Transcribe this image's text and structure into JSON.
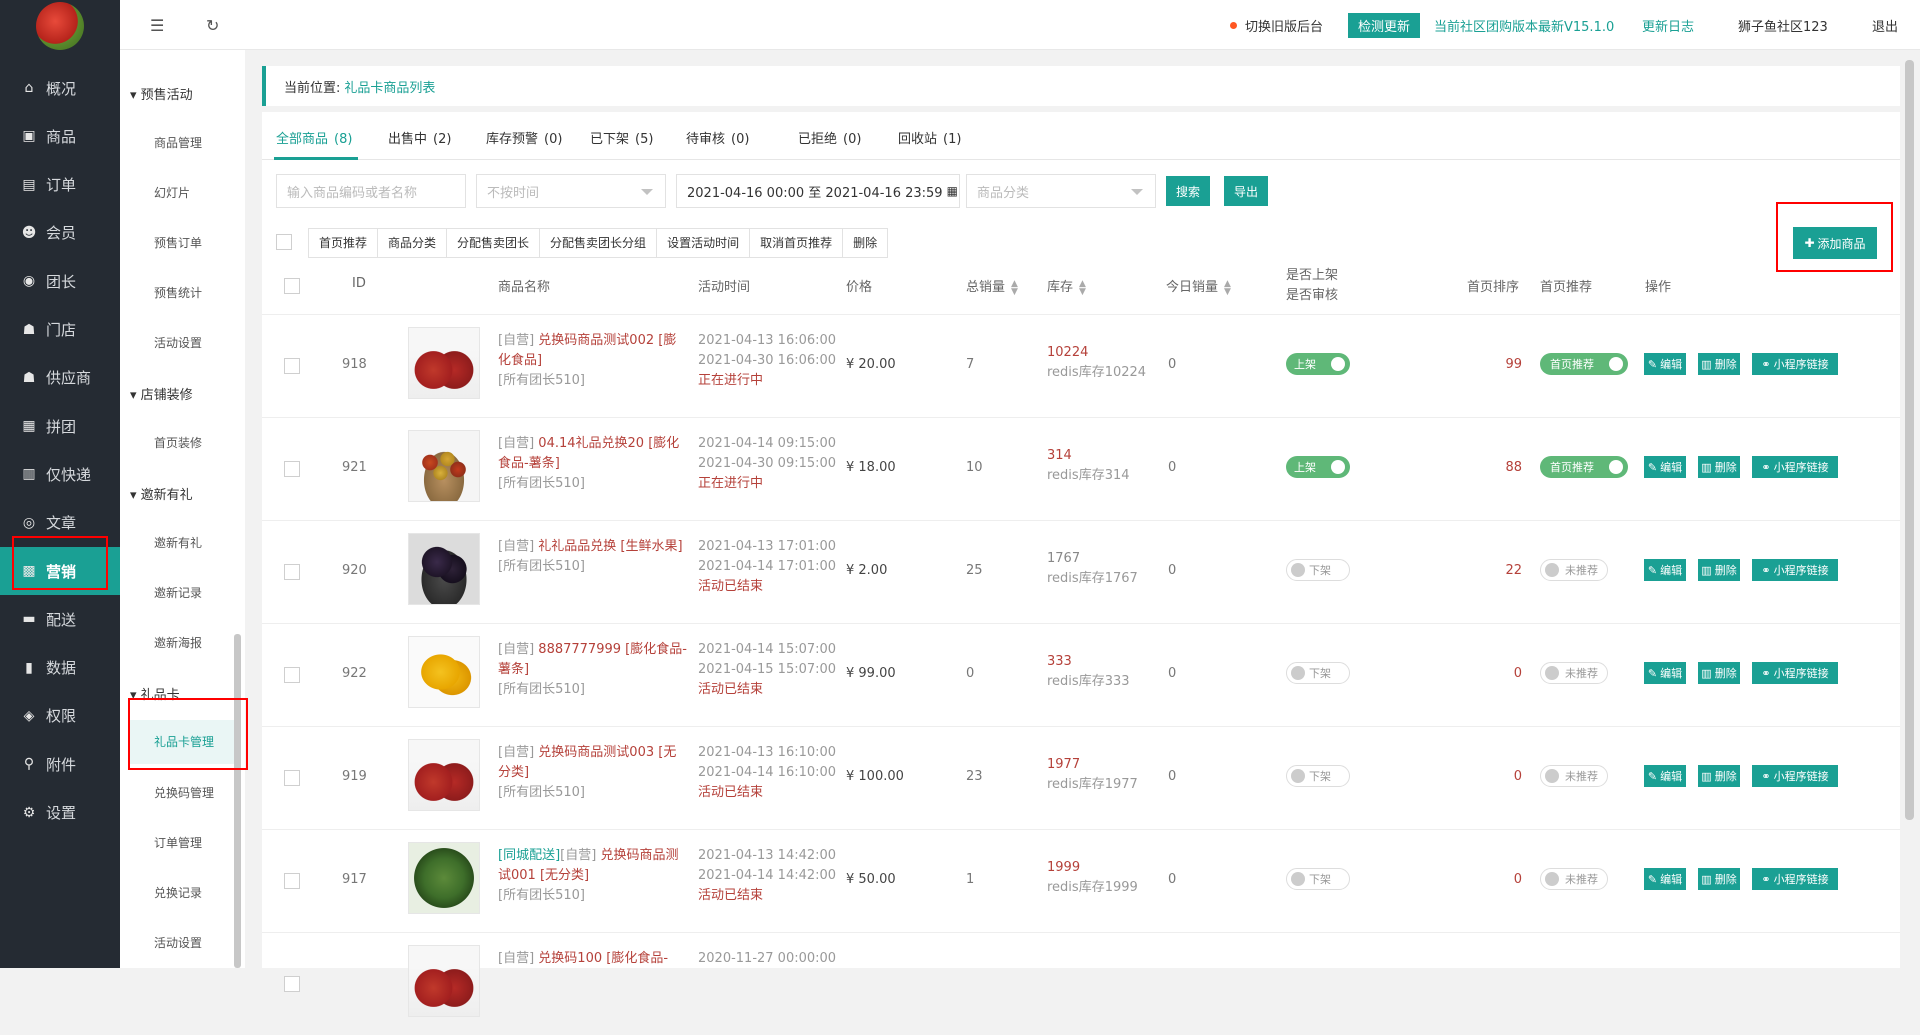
{
  "sidebar": {
    "items": [
      {
        "label": "概况",
        "icon": "home-icon",
        "glyph": "⌂"
      },
      {
        "label": "商品",
        "icon": "product-icon",
        "glyph": "▣"
      },
      {
        "label": "订单",
        "icon": "order-icon",
        "glyph": "▤"
      },
      {
        "label": "会员",
        "icon": "member-icon",
        "glyph": "☻"
      },
      {
        "label": "团长",
        "icon": "leader-icon",
        "glyph": "◉"
      },
      {
        "label": "门店",
        "icon": "store-icon",
        "glyph": "☗"
      },
      {
        "label": "供应商",
        "icon": "supplier-icon",
        "glyph": "☗"
      },
      {
        "label": "拼团",
        "icon": "group-icon",
        "glyph": "▦"
      },
      {
        "label": "仅快递",
        "icon": "express-icon",
        "glyph": "▥"
      },
      {
        "label": "文章",
        "icon": "article-icon",
        "glyph": "◎"
      },
      {
        "label": "营销",
        "icon": "marketing-icon",
        "glyph": "▩"
      },
      {
        "label": "配送",
        "icon": "delivery-icon",
        "glyph": "▬"
      },
      {
        "label": "数据",
        "icon": "data-icon",
        "glyph": "▮"
      },
      {
        "label": "权限",
        "icon": "permission-icon",
        "glyph": "◈"
      },
      {
        "label": "附件",
        "icon": "attachment-icon",
        "glyph": "⚲"
      },
      {
        "label": "设置",
        "icon": "settings-icon",
        "glyph": "⚙"
      }
    ]
  },
  "subnav": {
    "presale": "预售活动",
    "presale_items": [
      "商品管理",
      "幻灯片",
      "预售订单",
      "预售统计",
      "活动设置"
    ],
    "decor": "店铺装修",
    "decor_items": [
      "首页装修"
    ],
    "invite": "邀新有礼",
    "invite_items": [
      "邀新有礼",
      "邀新记录",
      "邀新海报"
    ],
    "gift": "礼品卡",
    "gift_items": [
      "礼品卡管理",
      "兑换码管理",
      "订单管理",
      "兑换记录",
      "活动设置"
    ]
  },
  "topbar": {
    "switch_old": "切换旧版后台",
    "check_update": "检测更新",
    "version": "当前社区团购版本最新V15.1.0",
    "changelog": "更新日志",
    "user": "狮子鱼社区123",
    "logout": "退出"
  },
  "breadcrumb": {
    "prefix": "当前位置:",
    "current": "礼品卡商品列表"
  },
  "tabs": [
    {
      "label": "全部商品",
      "count": "(8)"
    },
    {
      "label": "出售中",
      "count": "(2)"
    },
    {
      "label": "库存预警",
      "count": "(0)"
    },
    {
      "label": "已下架",
      "count": "(5)"
    },
    {
      "label": "待审核",
      "count": "(0)"
    },
    {
      "label": "已拒绝",
      "count": "(0)"
    },
    {
      "label": "回收站",
      "count": "(1)"
    }
  ],
  "filters": {
    "keyword_placeholder": "输入商品编码或者名称",
    "time_type": "不按时间",
    "date_range": "2021-04-16 00:00 至 2021-04-16 23:59",
    "category": "商品分类",
    "search": "搜索",
    "export": "导出"
  },
  "batch": [
    "首页推荐",
    "商品分类",
    "分配售卖团长",
    "分配售卖团长分组",
    "设置活动时间",
    "取消首页推荐",
    "删除"
  ],
  "add_button": "添加商品",
  "columns": {
    "id": "ID",
    "name": "商品名称",
    "time": "活动时间",
    "price": "价格",
    "total_sales": "总销量",
    "stock": "库存",
    "today_sales": "今日销量",
    "onshelf_line1": "是否上架",
    "onshelf_line2": "是否审核",
    "home_order": "首页排序",
    "home_rec": "首页推荐",
    "ops": "操作"
  },
  "row_labels": {
    "edit": "编辑",
    "delete": "删除",
    "mini_link": "小程序链接",
    "on": "上架",
    "off": "下架",
    "rec_on": "首页推荐",
    "rec_off": "未推荐"
  },
  "rows": [
    {
      "id": "918",
      "tag": "[自营]",
      "name": "兑换码商品测试002 [膨化食品]",
      "group": "[所有团长510]",
      "start": "2021-04-13 16:06:00",
      "end": "2021-04-30 16:06:00",
      "status": "正在进行中",
      "price": "¥ 20.00",
      "sales": "7",
      "stock": "10224",
      "redis": "redis库存10224",
      "today": "0",
      "onshelf": true,
      "order": "99",
      "rec": true,
      "img": "meat"
    },
    {
      "id": "921",
      "tag": "[自营]",
      "name": "04.14礼品兑换20 [膨化食品-薯条]",
      "group": "[所有团长510]",
      "start": "2021-04-14 09:15:00",
      "end": "2021-04-30 09:15:00",
      "status": "正在进行中",
      "price": "¥ 18.00",
      "sales": "10",
      "stock": "314",
      "redis": "redis库存314",
      "today": "0",
      "onshelf": true,
      "order": "88",
      "rec": true,
      "img": "dates"
    },
    {
      "id": "920",
      "tag": "[自营]",
      "name": "礼礼品品兑换 [生鲜水果]",
      "group": "[所有团长510]",
      "start": "2021-04-13 17:01:00",
      "end": "2021-04-14 17:01:00",
      "status": "活动已结束",
      "price": "¥ 2.00",
      "sales": "25",
      "stock": "1767",
      "redis": "redis库存1767",
      "today": "0",
      "onshelf": false,
      "order": "22",
      "rec": false,
      "img": "berries"
    },
    {
      "id": "922",
      "tag": "[自营]",
      "name": "8887777999 [膨化食品-薯条]",
      "group": "[所有团长510]",
      "start": "2021-04-14 15:07:00",
      "end": "2021-04-15 15:07:00",
      "status": "活动已结束",
      "price": "¥ 99.00",
      "sales": "0",
      "stock": "333",
      "redis": "redis库存333",
      "today": "0",
      "onshelf": false,
      "order": "0",
      "rec": false,
      "img": "mango"
    },
    {
      "id": "919",
      "tag": "[自营]",
      "name": "兑换码商品测试003 [无分类]",
      "group": "[所有团长510]",
      "start": "2021-04-13 16:10:00",
      "end": "2021-04-14 16:10:00",
      "status": "活动已结束",
      "price": "¥ 100.00",
      "sales": "23",
      "stock": "1977",
      "redis": "redis库存1977",
      "today": "0",
      "onshelf": false,
      "order": "0",
      "rec": false,
      "img": "meat"
    },
    {
      "id": "917",
      "tag2": "[同城配送]",
      "tag": "[自营]",
      "name": "兑换码商品测试001 [无分类]",
      "group": "[所有团长510]",
      "start": "2021-04-13 14:42:00",
      "end": "2021-04-14 14:42:00",
      "status": "活动已结束",
      "price": "¥ 50.00",
      "sales": "1",
      "stock": "1999",
      "redis": "redis库存1999",
      "today": "0",
      "onshelf": false,
      "order": "0",
      "rec": false,
      "img": "greens"
    },
    {
      "id": "",
      "tag": "[自营]",
      "name": "兑换码100 [膨化食品-",
      "group": "",
      "start": "2020-11-27 00:00:00",
      "end": "",
      "status": "",
      "price": "",
      "sales": "",
      "stock": "",
      "redis": "",
      "today": "",
      "onshelf": null,
      "order": "",
      "rec": null,
      "img": "meat"
    }
  ]
}
